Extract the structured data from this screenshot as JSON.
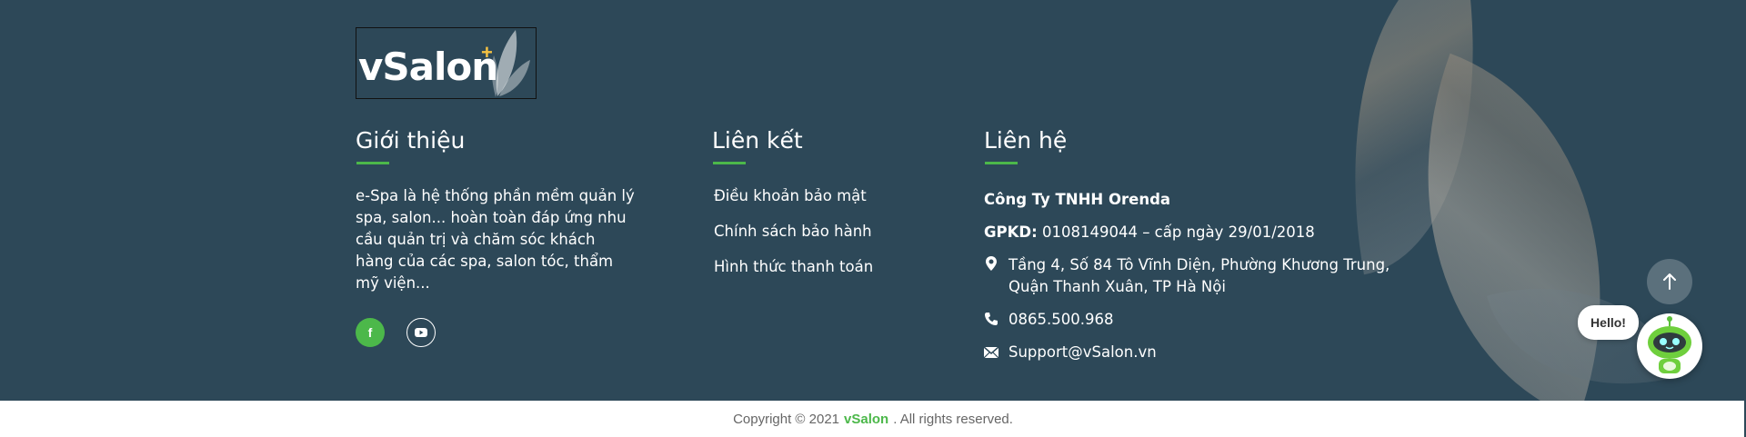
{
  "logo": {
    "text": "vSalon",
    "plus": "+"
  },
  "about": {
    "title": "Giới thiệu",
    "text": "e-Spa là hệ thống phần mềm quản lý spa, salon... hoàn toàn đáp ứng nhu cầu quản trị và chăm sóc khách hàng của các spa, salon tóc, thẩm mỹ viện...",
    "social": [
      {
        "icon": "facebook-icon",
        "glyph": "f"
      },
      {
        "icon": "youtube-icon",
        "glyph": "▶"
      }
    ]
  },
  "links": {
    "title": "Liên kết",
    "items": [
      "Điều khoản bảo mật",
      "Chính sách bảo hành",
      "Hình thức thanh toán"
    ]
  },
  "contact": {
    "title": "Liên hệ",
    "company": "Công Ty TNHH Orenda",
    "license_label": "GPKD:",
    "license_value": "0108149044 – cấp ngày 29/01/2018",
    "address_line1": "Tầng 4, Số 84 Tô Vĩnh Diện, Phường Khương Trung,",
    "address_line2": "Quận Thanh Xuân, TP Hà Nội",
    "phone": "0865.500.968",
    "email": "Support@vSalon.vn"
  },
  "chat": {
    "bubble": "Hello!"
  },
  "copyright": {
    "prefix": "Copyright © 2021",
    "brand": "vSalon",
    "suffix": ". All rights reserved."
  },
  "colors": {
    "footer_bg": "#2d4858",
    "accent": "#4cb84a",
    "logo_plus": "#f5c242"
  }
}
